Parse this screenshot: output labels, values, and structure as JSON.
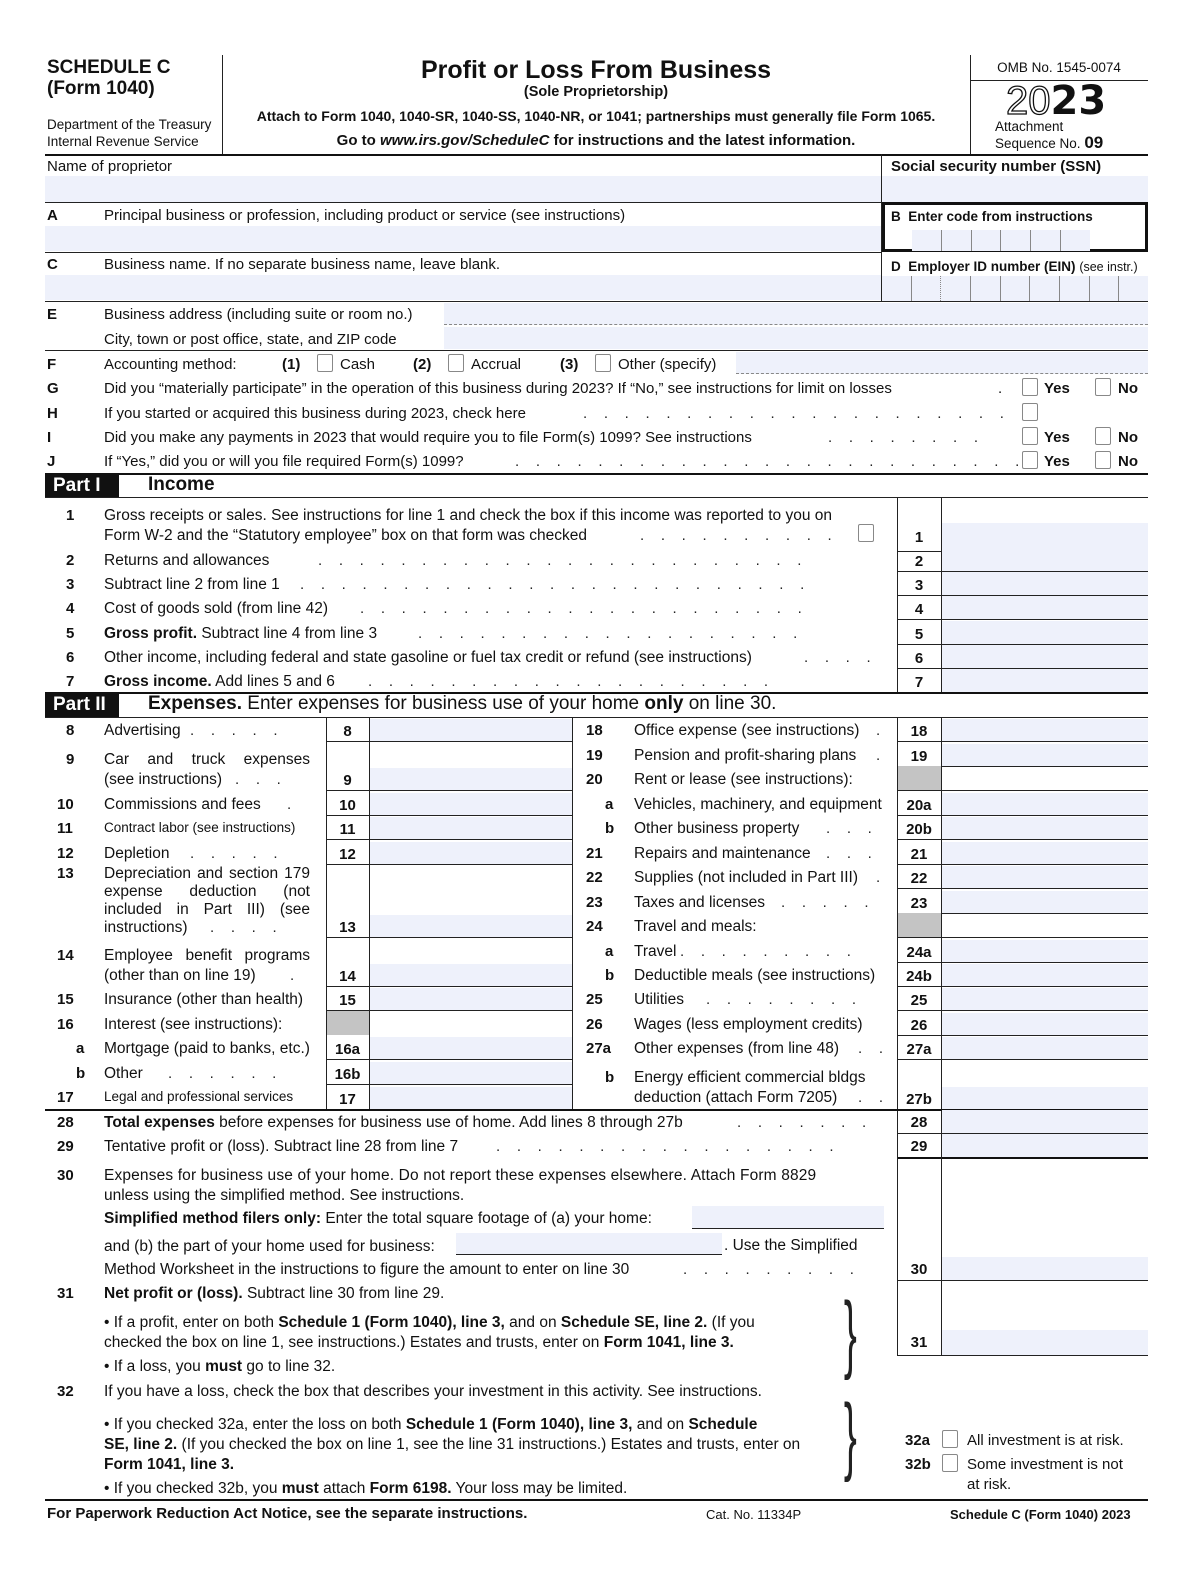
{
  "header": {
    "schedule": "SCHEDULE C",
    "form": "(Form 1040)",
    "dept1": "Department of the Treasury",
    "dept2": "Internal Revenue Service",
    "title": "Profit or Loss From Business",
    "subtitle": "(Sole Proprietorship)",
    "attach": "Attach to Form 1040, 1040-SR, 1040-SS, 1040-NR, or 1041; partnerships must generally file Form 1065.",
    "goto_prefix": "Go to ",
    "goto_url": "www.irs.gov/ScheduleC",
    "goto_suffix": " for instructions and the latest information.",
    "omb": "OMB No. 1545-0074",
    "year_outline": "20",
    "year_bold": "23",
    "attachment": "Attachment",
    "sequence_label": "Sequence No. ",
    "sequence_no": "09"
  },
  "identity": {
    "name_label": "Name of proprietor",
    "name_value": "",
    "ssn_label": "Social security number (SSN)",
    "ssn_value": "",
    "a_letter": "A",
    "a_label": "Principal business or profession, including product or service (see instructions)",
    "a_value": "",
    "b_letter": "B",
    "b_label": "Enter code from instructions",
    "c_letter": "C",
    "c_label": "Business name. If no separate business name, leave blank.",
    "c_value": "",
    "d_letter": "D",
    "d_label": "Employer ID number (EIN)",
    "d_note": "(see instr.)",
    "e_letter": "E",
    "e_label1": "Business address (including suite or room no.)",
    "e_label2": "City, town or post office, state, and ZIP code",
    "e_value1": "",
    "e_value2": ""
  },
  "questions": {
    "f_letter": "F",
    "f_label": "Accounting method:",
    "f_opt1_num": "(1)",
    "f_opt1": "Cash",
    "f_opt2_num": "(2)",
    "f_opt2": "Accrual",
    "f_opt3_num": "(3)",
    "f_opt3": "Other (specify)",
    "g_letter": "G",
    "g_label": "Did you “materially participate” in the operation of this business during 2023? If “No,” see instructions for limit on losses",
    "h_letter": "H",
    "h_label": "If you started or acquired this business during 2023, check here",
    "i_letter": "I",
    "i_label": "Did you make any payments in 2023 that would require you to file Form(s) 1099? See instructions",
    "j_letter": "J",
    "j_label": "If “Yes,” did you or will you file required Form(s) 1099?",
    "yes": "Yes",
    "no": "No"
  },
  "part1": {
    "tag": "Part I",
    "title": "Income",
    "lines": [
      {
        "num": "1",
        "text": "Gross receipts or sales. See instructions for line 1 and check the box if this income was reported to you on",
        "text2": "Form W-2 and the “Statutory employee” box on that form was checked",
        "box": "1",
        "value": ""
      },
      {
        "num": "2",
        "text": "Returns and allowances",
        "box": "2",
        "value": ""
      },
      {
        "num": "3",
        "text": "Subtract line 2 from line 1",
        "box": "3",
        "value": ""
      },
      {
        "num": "4",
        "text": "Cost of goods sold (from line 42)",
        "box": "4",
        "value": ""
      },
      {
        "num": "5",
        "bold": "Gross profit.",
        "text": " Subtract line 4 from line 3",
        "box": "5",
        "value": ""
      },
      {
        "num": "6",
        "text": "Other income, including federal and state gasoline or fuel tax credit or refund (see instructions)",
        "box": "6",
        "value": ""
      },
      {
        "num": "7",
        "bold": "Gross income.",
        "text": " Add lines 5 and 6",
        "box": "7",
        "value": ""
      }
    ]
  },
  "part2": {
    "tag": "Part II",
    "title_bold": "Expenses.",
    "title_rest": " Enter expenses for business use of your home ",
    "title_only": "only",
    "title_end": " on line 30.",
    "left": [
      {
        "num": "8",
        "text": "Advertising",
        "box": "8"
      },
      {
        "num": "9",
        "text": "Car and truck expenses",
        "text2": "(see instructions)",
        "box": "9"
      },
      {
        "num": "10",
        "text": "Commissions and fees",
        "box": "10"
      },
      {
        "num": "11",
        "text": "Contract labor (see instructions)",
        "box": "11"
      },
      {
        "num": "12",
        "text": "Depletion",
        "box": "12"
      },
      {
        "num": "13",
        "text": "Depreciation and section 179",
        "text2": "expense deduction (not",
        "text3": "included in Part III) (see",
        "text4": "instructions)",
        "box": "13"
      },
      {
        "num": "14",
        "text": "Employee benefit programs",
        "text2": "(other than on line 19)",
        "box": "14"
      },
      {
        "num": "15",
        "text": "Insurance (other than health)",
        "box": "15"
      },
      {
        "num": "16",
        "text": "Interest (see instructions):",
        "box": ""
      },
      {
        "num": "a",
        "text": "Mortgage (paid to banks, etc.)",
        "box": "16a"
      },
      {
        "num": "b",
        "text": "Other",
        "box": "16b"
      },
      {
        "num": "17",
        "text": "Legal and professional services",
        "box": "17"
      }
    ],
    "right": [
      {
        "num": "18",
        "text": "Office expense (see instructions)",
        "box": "18"
      },
      {
        "num": "19",
        "text": "Pension and profit-sharing plans",
        "box": "19"
      },
      {
        "num": "20",
        "text": "Rent or lease (see instructions):",
        "box": ""
      },
      {
        "num": "a",
        "text": "Vehicles, machinery, and equipment",
        "box": "20a"
      },
      {
        "num": "b",
        "text": "Other business property",
        "box": "20b"
      },
      {
        "num": "21",
        "text": "Repairs and maintenance",
        "box": "21"
      },
      {
        "num": "22",
        "text": "Supplies (not included in Part III)",
        "box": "22"
      },
      {
        "num": "23",
        "text": "Taxes and licenses",
        "box": "23"
      },
      {
        "num": "24",
        "text": "Travel and meals:",
        "box": ""
      },
      {
        "num": "a",
        "text": "Travel",
        "box": "24a"
      },
      {
        "num": "b",
        "text": "Deductible meals (see instructions)",
        "box": "24b"
      },
      {
        "num": "25",
        "text": "Utilities",
        "box": "25"
      },
      {
        "num": "26",
        "text": "Wages (less employment credits)",
        "box": "26"
      },
      {
        "num": "27a",
        "text": "Other expenses (from line 48)",
        "box": "27a"
      },
      {
        "num": "b",
        "text": "Energy efficient commercial bldgs",
        "text2": "deduction (attach Form 7205)",
        "box": "27b"
      }
    ]
  },
  "totals": {
    "l28_num": "28",
    "l28_bold": "Total expenses",
    "l28_text": " before expenses for business use of home. Add lines 8 through 27b",
    "l28_box": "28",
    "l29_num": "29",
    "l29_text": "Tentative profit or (loss). Subtract line 28 from line 7",
    "l29_box": "29",
    "l30_num": "30",
    "l30_text1": "Expenses for business use of your home. Do not report these expenses elsewhere. Attach Form 8829",
    "l30_text2": "unless using the simplified method. See instructions.",
    "l30_simpl_bold": "Simplified method filers only:",
    "l30_simpl_text": " Enter the total square footage of (a) your home:",
    "l30_b_text": "and (b) the part of your home used for business:",
    "l30_b_after": ". Use the Simplified",
    "l30_text4": "Method Worksheet in the instructions to figure the amount to enter on line 30",
    "l30_box": "30",
    "l30_home_sqft": "",
    "l30_business_sqft": "",
    "l31_num": "31",
    "l31_bold": "Net profit or (loss).",
    "l31_text": " Subtract line 30 from line 29.",
    "l31_b1_a": "• If a profit, enter on both ",
    "l31_b1_b": "Schedule 1 (Form 1040), line 3,",
    "l31_b1_c": " and on ",
    "l31_b1_d": "Schedule SE, line 2.",
    "l31_b1_e": " (If you",
    "l31_b1_f": "checked the box on line 1, see instructions.) Estates and trusts, enter on ",
    "l31_b1_g": "Form 1041, line 3.",
    "l31_b2_a": "• If a loss, you ",
    "l31_b2_b": "must",
    "l31_b2_c": "  go to line 32.",
    "l31_box": "31",
    "l32_num": "32",
    "l32_text": "If you have a loss, check the box that describes your investment in this activity. See instructions.",
    "l32_b1_a": "• If you checked 32a, enter the loss on both ",
    "l32_b1_b": "Schedule 1 (Form 1040), line 3,",
    "l32_b1_c": " and on ",
    "l32_b1_d": "Schedule",
    "l32_b1_e": "SE, line 2.",
    "l32_b1_f": " (If you checked the box on line 1, see the line 31 instructions.) Estates and trusts, enter on",
    "l32_b1_g": "Form 1041, line 3.",
    "l32_b2_a": "• If you checked 32b, you ",
    "l32_b2_b": "must",
    "l32_b2_c": " attach ",
    "l32_b2_d": "Form 6198.",
    "l32_b2_e": " Your loss may be limited.",
    "l32a": "32a",
    "l32a_text": "All investment is at risk.",
    "l32b": "32b",
    "l32b_text": "Some investment is not",
    "l32b_text2": "at risk."
  },
  "footer": {
    "notice": "For Paperwork Reduction Act Notice, see the separate instructions.",
    "cat": "Cat. No. 11334P",
    "form": "Schedule C (Form 1040) 2023"
  },
  "colors": {
    "field_fill": "#eef1fb",
    "shaded_box": "#c4c4c4",
    "part_bar": "#111111"
  }
}
